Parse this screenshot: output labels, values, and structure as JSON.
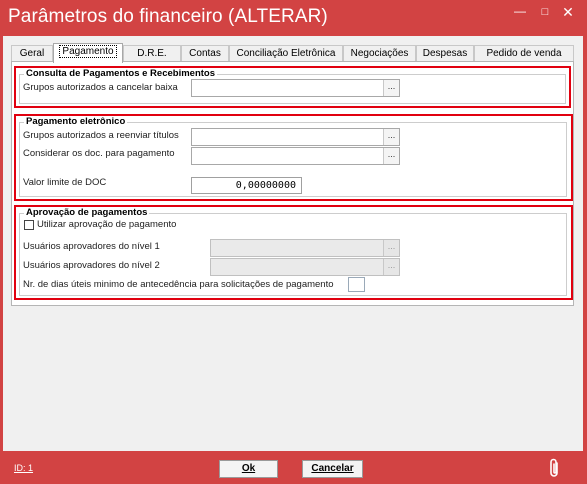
{
  "window": {
    "title": "Parâmetros do financeiro (ALTERAR)",
    "minimize_icon": "minimize-icon",
    "maximize_icon": "maximize-icon",
    "close_icon": "close-icon",
    "minimize_glyph": "—",
    "maximize_glyph": "□",
    "close_glyph": "✕",
    "accent_color": "#d24343"
  },
  "tabs": [
    {
      "label": "Geral",
      "active": false
    },
    {
      "label": "Pagamento",
      "active": true
    },
    {
      "label": "D.R.E.",
      "active": false
    },
    {
      "label": "Contas",
      "active": false
    },
    {
      "label": "Conciliação Eletrônica",
      "active": false
    },
    {
      "label": "Negociações",
      "active": false
    },
    {
      "label": "Despesas",
      "active": false
    },
    {
      "label": "Pedido de venda",
      "active": false
    }
  ],
  "consulta": {
    "legend": "Consulta de Pagamentos e Recebimentos",
    "grupos_cancelar_label": "Grupos autorizados a cancelar baixa",
    "grupos_cancelar_value": "",
    "ellipsis": "..."
  },
  "pagamento_eletronico": {
    "legend": "Pagamento eletrônico",
    "grupos_reenviar_label": "Grupos autorizados a reenviar títulos",
    "grupos_reenviar_value": "",
    "considerar_label": "Considerar os doc. para pagamento",
    "considerar_value": "",
    "valor_doc_label": "Valor limite de DOC",
    "valor_doc_value": "0,00000000",
    "ellipsis": "..."
  },
  "aprovacao": {
    "legend": "Aprovação de pagamentos",
    "utilizar_label": "Utilizar aprovação de pagamento",
    "utilizar_checked": false,
    "nivel1_label": "Usuários aprovadores do nível 1",
    "nivel1_value": "",
    "nivel2_label": "Usuários aprovadores do nível 2",
    "nivel2_value": "",
    "dias_label": "Nr. de dias úteis minimo de antecedência para solicitações de pagamento",
    "dias_value": "",
    "ellipsis": "..."
  },
  "footer": {
    "id_label": "ID: 1",
    "ok_label": "Ok",
    "cancel_label": "Cancelar",
    "attachment_icon": "paperclip-icon"
  }
}
